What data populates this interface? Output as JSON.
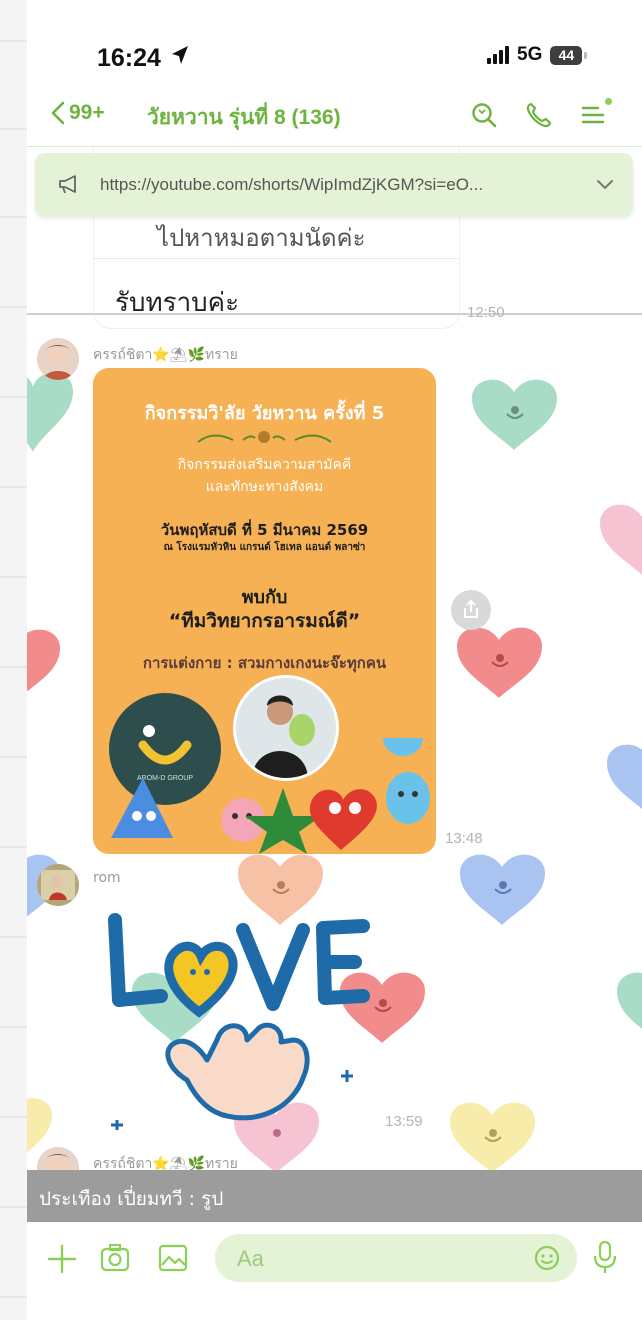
{
  "status_bar": {
    "time": "16:24",
    "network": "5G",
    "battery": "44"
  },
  "header": {
    "back_count": "99+",
    "title": "วัยหวาน รุ่นที่ 8 (136)",
    "icons": [
      "search-icon",
      "phone-icon",
      "menu-icon"
    ],
    "accent_color": "#6db33f"
  },
  "announcement": {
    "text": "https://youtube.com/shorts/WipImdZjKGM?si=eO..."
  },
  "previous_message": {
    "line1": "ไปหาหมอตามนัดค่ะ",
    "line2": "รับทราบค่ะ",
    "time": "12:50"
  },
  "messages": [
    {
      "sender": "ครรถ์ชิตา⭐⛱🌿ทราย",
      "type": "image",
      "time": "13:48",
      "poster": {
        "title": "กิจกรรมวิ'ลัย วัยหวาน ครั้งที่ 5",
        "subtitle1": "กิจกรรมส่งเสริมความสามัคคี",
        "subtitle2": "และทักษะทางสังคม",
        "date": "วันพฤหัสบดี ที่ 5 มีนาคม 2569",
        "venue": "ณ โรงแรมหัวหิน แกรนด์ โฮเทล แอนด์ พลาซ่า",
        "meet": "พบกับ",
        "team": "“ทีมวิทยากรอารมณ์ดี”",
        "dress": "การแต่งกาย : สวมกางเกงนะจ๊ะทุกคน",
        "logo_text": "AROM-D GROUP"
      }
    },
    {
      "sender": "rom",
      "type": "sticker",
      "sticker_text": "LOVE",
      "time": "13:59"
    },
    {
      "sender": "ครรถ์ชิตา⭐⛱🌿ทราย",
      "type": "partial"
    }
  ],
  "overlay_text": "ประเทือง เปี่ยมทวี : รูป",
  "input_bar": {
    "placeholder": "Aa",
    "icons": [
      "plus-icon",
      "camera-icon",
      "image-icon",
      "emoji-icon",
      "microphone-icon"
    ]
  }
}
